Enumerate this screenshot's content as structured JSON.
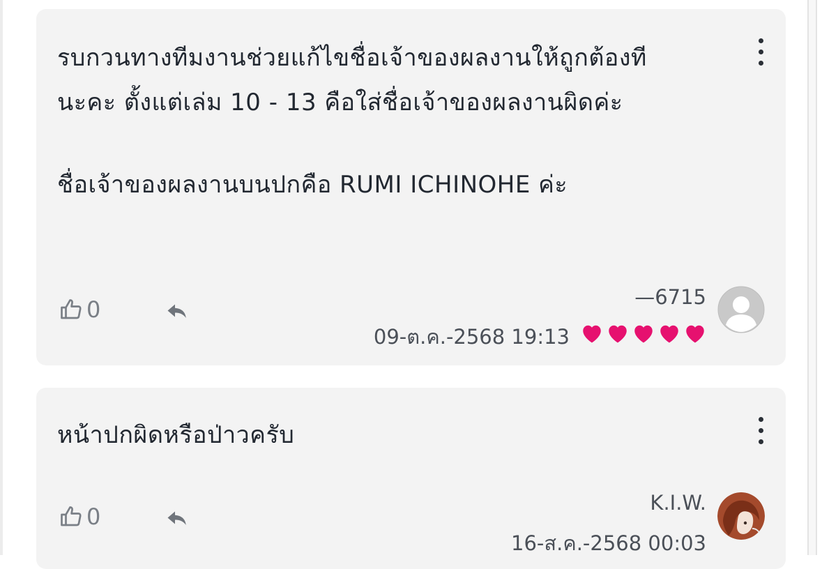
{
  "comments": [
    {
      "text_line1": "รบกวนทางทีมงานช่วยแก้ไขชื่อเจ้าของผลงานให้ถูกต้องที",
      "text_line2": "นะคะ ตั้งแต่เล่ม 10 - 13 คือใส่ชื่อเจ้าของผลงานผิดค่ะ",
      "text_para2": "ชื่อเจ้าของผลงานบนปกคือ RUMI ICHINOHE ค่ะ",
      "like_count": "0",
      "author": "—6715",
      "date": "09-ต.ค.-2568 19:13",
      "hearts": 5,
      "avatar": "default-user-icon"
    },
    {
      "text_line1": "หน้าปกผิดหรือป่าวครับ",
      "like_count": "0",
      "author": "K.I.W.",
      "date": "16-ส.ค.-2568 00:03",
      "avatar": "user-photo"
    }
  ],
  "colors": {
    "heart": "#e6116f",
    "card_bg": "#f3f3f3",
    "text": "#222831",
    "meta": "#4b5058"
  },
  "icons": {
    "like": "thumbs-up-icon",
    "reply": "reply-arrow-icon",
    "menu": "more-vertical-icon"
  }
}
